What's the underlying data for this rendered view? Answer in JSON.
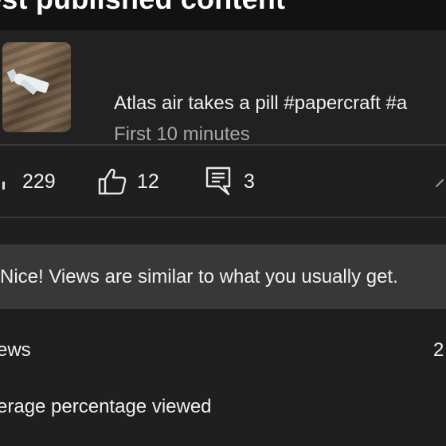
{
  "section": {
    "title": "est published content"
  },
  "video": {
    "title": "Atlas air takes a pill #papercraft #a",
    "subtitle": "First 10 minutes"
  },
  "stats": {
    "views": "229",
    "likes": "12",
    "comments": "3"
  },
  "banner": {
    "text": "Nice! Views are similar to what you usually get."
  },
  "metrics": [
    {
      "label": "ews",
      "value": "2"
    },
    {
      "label": "erage percentage viewed",
      "value": ""
    }
  ],
  "icons": {
    "likes": "thumbs-up-icon",
    "comments": "comment-icon",
    "expand": "chevron-up-icon"
  },
  "colors": {
    "background": "#1f1f1f",
    "banner": "#383838",
    "secondary_text": "#a8a8a8"
  }
}
